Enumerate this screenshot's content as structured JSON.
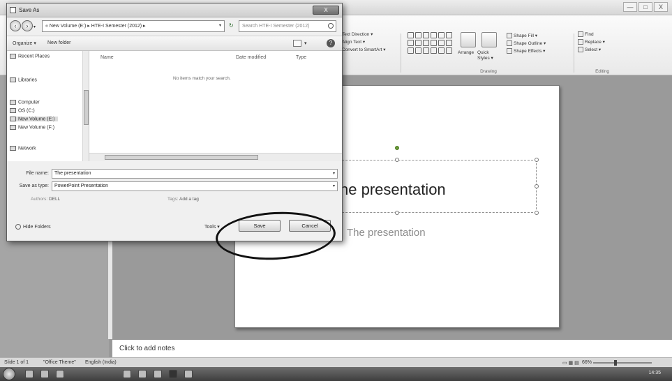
{
  "window": {
    "minimize": "—",
    "maximize": "□",
    "close": "X"
  },
  "ribbon": {
    "paragraph": {
      "text_direction": "Text Direction ▾",
      "align_text": "Align Text ▾",
      "convert_smartart": "Convert to SmartArt ▾"
    },
    "drawing": {
      "arrange": "Arrange",
      "quick_styles": "Quick Styles ▾",
      "shape_fill": "Shape Fill ▾",
      "shape_outline": "Shape Outline ▾",
      "shape_effects": "Shape Effects ▾",
      "group_label": "Drawing"
    },
    "editing": {
      "find": "Find",
      "replace": "Replace ▾",
      "select": "Select ▾",
      "group_label": "Editing"
    }
  },
  "slide": {
    "title": "he presentation",
    "subtitle": "The presentation"
  },
  "notes": {
    "placeholder": "Click to add notes"
  },
  "statusbar": {
    "slide_count": "Slide 1 of 1",
    "theme": "\"Office Theme\"",
    "language": "English (India)",
    "zoom": "66%"
  },
  "taskbar": {
    "time": "14:35"
  },
  "dialog": {
    "title": "Save As",
    "close": "X",
    "address": "« New Volume (E:) ▸ HTE-I Semester (2012) ▸",
    "search_placeholder": "Search HTE-I Semester (2012)",
    "organize": "Organize ▾",
    "new_folder": "New folder",
    "help": "?",
    "nav": {
      "recent_places": "Recent Places",
      "libraries": "Libraries",
      "computer": "Computer",
      "os_c": "OS (C:)",
      "new_volume_e": "New Volume (E:)",
      "new_volume_f": "New Volume (F:)",
      "network": "Network"
    },
    "columns": {
      "name": "Name",
      "date_modified": "Date modified",
      "type": "Type"
    },
    "empty_message": "No items match your search.",
    "file_name_label": "File name:",
    "file_name_value": "The presentation",
    "save_as_type_label": "Save as type:",
    "save_as_type_value": "PowerPoint Presentation",
    "authors_label": "Authors:",
    "authors_value": "DELL",
    "tags_label": "Tags:",
    "tags_value": "Add a tag",
    "hide_folders": "Hide Folders",
    "tools": "Tools ▾",
    "save": "Save",
    "cancel": "Cancel"
  }
}
